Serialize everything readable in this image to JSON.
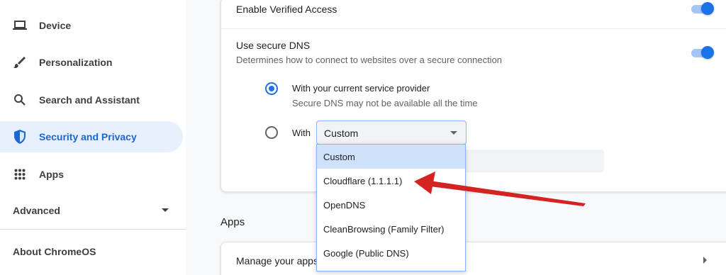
{
  "sidebar": {
    "items": [
      {
        "label": "Device",
        "icon": "laptop-icon"
      },
      {
        "label": "Personalization",
        "icon": "brush-icon"
      },
      {
        "label": "Search and Assistant",
        "icon": "search-icon"
      },
      {
        "label": "Security and Privacy",
        "icon": "shield-icon",
        "active": true
      },
      {
        "label": "Apps",
        "icon": "grid-icon"
      }
    ],
    "advanced_label": "Advanced",
    "about_label": "About ChromeOS"
  },
  "security": {
    "verified_access_label": "Enable Verified Access",
    "verified_access_on": true,
    "secure_dns_label": "Use secure DNS",
    "secure_dns_desc": "Determines how to connect to websites over a secure connection",
    "secure_dns_on": true,
    "option_current_title": "With your current service provider",
    "option_current_sub": "Secure DNS may not be available all the time",
    "option_with_label": "With",
    "selected_provider": "Custom"
  },
  "dropdown": {
    "options": [
      "Custom",
      "Cloudflare (1.1.1.1)",
      "OpenDNS",
      "CleanBrowsing (Family Filter)",
      "Google (Public DNS)"
    ]
  },
  "apps_section": {
    "title": "Apps",
    "manage_label": "Manage your apps"
  },
  "colors": {
    "accent": "#1a73e8",
    "active_bg": "#e8f0fe",
    "annotation_arrow": "#d32323"
  }
}
